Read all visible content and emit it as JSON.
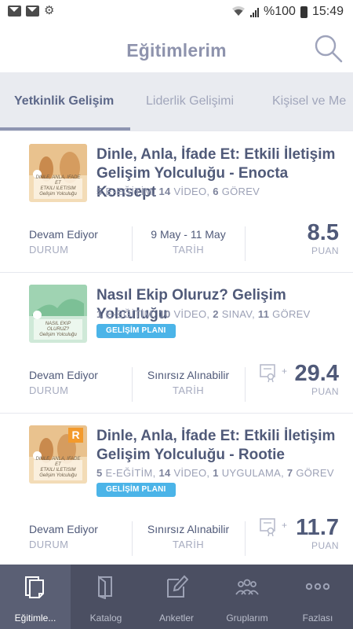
{
  "status_bar": {
    "battery_percent": "%100",
    "time": "15:49"
  },
  "header": {
    "title": "Eğitimlerim",
    "search_icon": "search-icon"
  },
  "tabs": [
    {
      "label": "Yetkinlik Gelişim",
      "active": true
    },
    {
      "label": "Liderlik Gelişimi",
      "active": false
    },
    {
      "label": "Kişisel ve Me",
      "active": false
    }
  ],
  "cards": [
    {
      "title_line1": "Dinle, Anla, İfade Et: Etkili İletişim",
      "title_line2": "Gelişim Yolculuğu - Enocta Konsept",
      "meta": [
        {
          "count": "5",
          "unit": "E-EĞİTİM"
        },
        {
          "count": "14",
          "unit": "VİDEO"
        },
        {
          "count": "6",
          "unit": "GÖREV"
        }
      ],
      "thumb_caption_1": "DINLE, ANLA, IFADE ET",
      "thumb_caption_2": "ETKILI ILETISIM",
      "thumb_caption_3": "Gelişim Yolculuğu",
      "status_value": "Devam Ediyor",
      "status_label": "DURUM",
      "date_value": "9 May - 11 May",
      "date_label": "TARİH",
      "score": "8.5",
      "score_label": "PUAN"
    },
    {
      "title_line1": "Nasıl Ekip Oluruz? Gelişim Yolculuğu",
      "meta": [
        {
          "count": "1",
          "unit": "E-EĞİTİM"
        },
        {
          "count": "10",
          "unit": "VİDEO"
        },
        {
          "count": "2",
          "unit": "SINAV"
        },
        {
          "count": "11",
          "unit": "GÖREV"
        }
      ],
      "badge": "GELİŞİM PLANI",
      "thumb_caption_1": "NASIL EKIP OLURUZ?",
      "thumb_caption_3": "Gelişim Yolculuğu",
      "status_value": "Devam Ediyor",
      "status_label": "DURUM",
      "date_value": "Sınırsız Alınabilir",
      "date_label": "TARİH",
      "plus": "+",
      "score": "29.4",
      "score_label": "PUAN"
    },
    {
      "title_line1": "Dinle, Anla, İfade Et: Etkili İletişim",
      "title_line2": "Gelişim Yolculuğu - Rootie",
      "meta": [
        {
          "count": "5",
          "unit": "E-EĞİTİM"
        },
        {
          "count": "14",
          "unit": "VİDEO"
        },
        {
          "count": "1",
          "unit": "UYGULAMA"
        },
        {
          "count": "7",
          "unit": "GÖREV"
        }
      ],
      "badge": "GELİŞİM PLANI",
      "thumb_badge": "R",
      "thumb_caption_1": "DINLE, ANLA, IFADE ET",
      "thumb_caption_2": "ETKILI ILETISIM",
      "thumb_caption_3": "Gelişim Yolculuğu",
      "status_value": "Devam Ediyor",
      "status_label": "DURUM",
      "date_value": "Sınırsız Alınabilir",
      "date_label": "TARİH",
      "plus": "+",
      "score": "11.7",
      "score_label": "PUAN"
    }
  ],
  "bottom_nav": [
    {
      "label": "Eğitimle...",
      "icon": "my-trainings-icon",
      "active": true
    },
    {
      "label": "Katalog",
      "icon": "catalog-icon",
      "active": false
    },
    {
      "label": "Anketler",
      "icon": "survey-icon",
      "active": false
    },
    {
      "label": "Gruplarım",
      "icon": "groups-icon",
      "active": false
    },
    {
      "label": "Fazlası",
      "icon": "more-icon",
      "active": false
    }
  ],
  "colors": {
    "title": "#8e93ad",
    "text_dark": "#505a79",
    "badge": "#4bb4e8",
    "nav_bg": "#4b4f62",
    "tab_bg": "#e9ebf0"
  }
}
